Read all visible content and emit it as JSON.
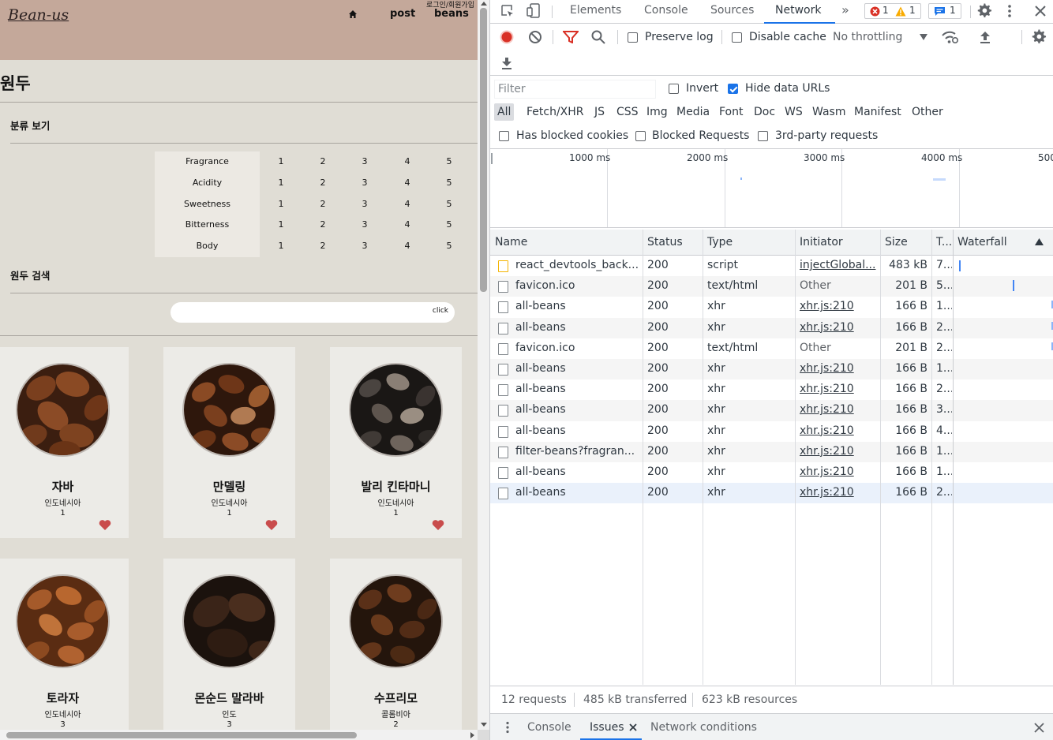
{
  "site": {
    "logo": "Bean-us",
    "nav": {
      "post": "post",
      "login": "로그인/회원가입",
      "beans": "beans"
    },
    "page_title": "원두",
    "filter_section_title": "분류 보기",
    "search_section_title": "원두 검색",
    "search": {
      "placeholder": "",
      "button": "click"
    },
    "flavors": [
      {
        "name": "Fragrance",
        "scale": [
          "1",
          "2",
          "3",
          "4",
          "5"
        ]
      },
      {
        "name": "Acidity",
        "scale": [
          "1",
          "2",
          "3",
          "4",
          "5"
        ]
      },
      {
        "name": "Sweetness",
        "scale": [
          "1",
          "2",
          "3",
          "4",
          "5"
        ]
      },
      {
        "name": "Bitterness",
        "scale": [
          "1",
          "2",
          "3",
          "4",
          "5"
        ]
      },
      {
        "name": "Body",
        "scale": [
          "1",
          "2",
          "3",
          "4",
          "5"
        ]
      }
    ],
    "beans": [
      {
        "name": "자바",
        "origin": "인도네시아",
        "count": "1"
      },
      {
        "name": "만델링",
        "origin": "인도네시아",
        "count": "1"
      },
      {
        "name": "발리 킨타마니",
        "origin": "인도네시아",
        "count": "1"
      },
      {
        "name": "토라자",
        "origin": "인도네시아",
        "count": "3"
      },
      {
        "name": "몬순드 말라바",
        "origin": "인도",
        "count": "3"
      },
      {
        "name": "수프리모",
        "origin": "콜롬비아",
        "count": "2"
      }
    ],
    "colors": {
      "header": "#c4a89a",
      "background": "#e0ddd5",
      "card": "#ecebe7",
      "heart": "#c94c4c"
    }
  },
  "devtools": {
    "tabs": [
      "Elements",
      "Console",
      "Sources",
      "Network"
    ],
    "active_tab": "Network",
    "badges": {
      "errors": "1",
      "warnings": "1",
      "messages": "1"
    },
    "toolbar": {
      "preserve_log": "Preserve log",
      "disable_cache": "Disable cache",
      "throttling": "No throttling"
    },
    "filter": {
      "placeholder": "Filter",
      "invert": "Invert",
      "hide_data_urls": "Hide data URLs",
      "types": [
        "All",
        "Fetch/XHR",
        "JS",
        "CSS",
        "Img",
        "Media",
        "Font",
        "Doc",
        "WS",
        "Wasm",
        "Manifest",
        "Other"
      ],
      "has_blocked_cookies": "Has blocked cookies",
      "blocked_requests": "Blocked Requests",
      "third_party": "3rd-party requests"
    },
    "overview_ticks": [
      "1000 ms",
      "2000 ms",
      "3000 ms",
      "4000 ms",
      "500"
    ],
    "columns": {
      "name": "Name",
      "status": "Status",
      "type": "Type",
      "initiator": "Initiator",
      "size": "Size",
      "time": "T...",
      "waterfall": "Waterfall"
    },
    "requests": [
      {
        "name": "react_devtools_back...",
        "status": "200",
        "type": "script",
        "initiator": "injectGlobal...",
        "size": "483 kB",
        "time": "7..."
      },
      {
        "name": "favicon.ico",
        "status": "200",
        "type": "text/html",
        "initiator": "Other",
        "size": "201 B",
        "time": "5..."
      },
      {
        "name": "all-beans",
        "status": "200",
        "type": "xhr",
        "initiator": "xhr.js:210",
        "size": "166 B",
        "time": "1..."
      },
      {
        "name": "all-beans",
        "status": "200",
        "type": "xhr",
        "initiator": "xhr.js:210",
        "size": "166 B",
        "time": "2..."
      },
      {
        "name": "favicon.ico",
        "status": "200",
        "type": "text/html",
        "initiator": "Other",
        "size": "201 B",
        "time": "2..."
      },
      {
        "name": "all-beans",
        "status": "200",
        "type": "xhr",
        "initiator": "xhr.js:210",
        "size": "166 B",
        "time": "1..."
      },
      {
        "name": "all-beans",
        "status": "200",
        "type": "xhr",
        "initiator": "xhr.js:210",
        "size": "166 B",
        "time": "2..."
      },
      {
        "name": "all-beans",
        "status": "200",
        "type": "xhr",
        "initiator": "xhr.js:210",
        "size": "166 B",
        "time": "3..."
      },
      {
        "name": "all-beans",
        "status": "200",
        "type": "xhr",
        "initiator": "xhr.js:210",
        "size": "166 B",
        "time": "4..."
      },
      {
        "name": "filter-beans?fragran...",
        "status": "200",
        "type": "xhr",
        "initiator": "xhr.js:210",
        "size": "166 B",
        "time": "1..."
      },
      {
        "name": "all-beans",
        "status": "200",
        "type": "xhr",
        "initiator": "xhr.js:210",
        "size": "166 B",
        "time": "1..."
      },
      {
        "name": "all-beans",
        "status": "200",
        "type": "xhr",
        "initiator": "xhr.js:210",
        "size": "166 B",
        "time": "2..."
      }
    ],
    "status_bar": {
      "requests": "12 requests",
      "transferred": "485 kB transferred",
      "resources": "623 kB resources"
    },
    "drawer_tabs": [
      "Console",
      "Issues",
      "Network conditions"
    ],
    "active_drawer_tab": "Issues",
    "colors": {
      "accent": "#1a73e8",
      "record": "#d93025",
      "filter_active": "#d93025"
    }
  }
}
